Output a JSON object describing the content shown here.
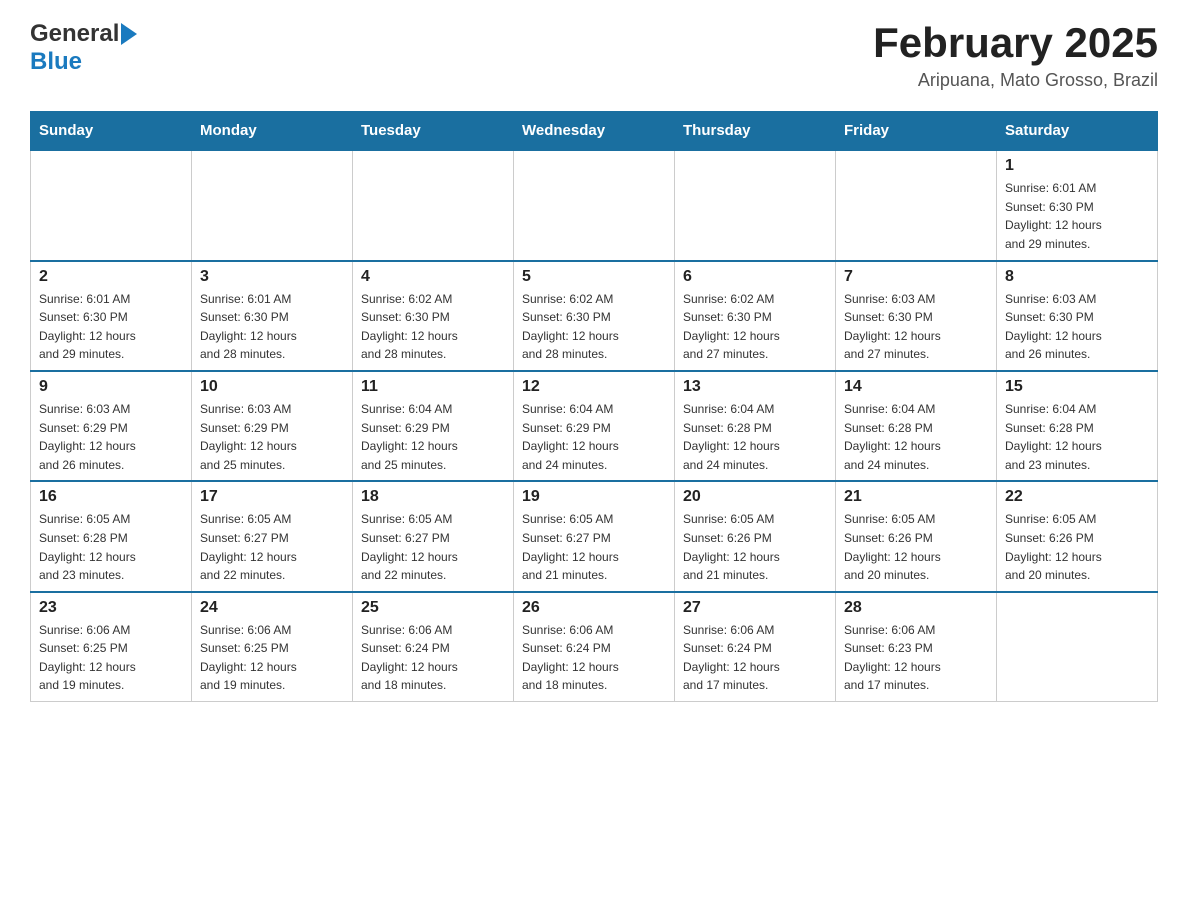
{
  "header": {
    "logo_general": "General",
    "logo_blue": "Blue",
    "title": "February 2025",
    "location": "Aripuana, Mato Grosso, Brazil"
  },
  "days_of_week": [
    "Sunday",
    "Monday",
    "Tuesday",
    "Wednesday",
    "Thursday",
    "Friday",
    "Saturday"
  ],
  "weeks": [
    {
      "days": [
        {
          "num": "",
          "info": ""
        },
        {
          "num": "",
          "info": ""
        },
        {
          "num": "",
          "info": ""
        },
        {
          "num": "",
          "info": ""
        },
        {
          "num": "",
          "info": ""
        },
        {
          "num": "",
          "info": ""
        },
        {
          "num": "1",
          "info": "Sunrise: 6:01 AM\nSunset: 6:30 PM\nDaylight: 12 hours\nand 29 minutes."
        }
      ]
    },
    {
      "days": [
        {
          "num": "2",
          "info": "Sunrise: 6:01 AM\nSunset: 6:30 PM\nDaylight: 12 hours\nand 29 minutes."
        },
        {
          "num": "3",
          "info": "Sunrise: 6:01 AM\nSunset: 6:30 PM\nDaylight: 12 hours\nand 28 minutes."
        },
        {
          "num": "4",
          "info": "Sunrise: 6:02 AM\nSunset: 6:30 PM\nDaylight: 12 hours\nand 28 minutes."
        },
        {
          "num": "5",
          "info": "Sunrise: 6:02 AM\nSunset: 6:30 PM\nDaylight: 12 hours\nand 28 minutes."
        },
        {
          "num": "6",
          "info": "Sunrise: 6:02 AM\nSunset: 6:30 PM\nDaylight: 12 hours\nand 27 minutes."
        },
        {
          "num": "7",
          "info": "Sunrise: 6:03 AM\nSunset: 6:30 PM\nDaylight: 12 hours\nand 27 minutes."
        },
        {
          "num": "8",
          "info": "Sunrise: 6:03 AM\nSunset: 6:30 PM\nDaylight: 12 hours\nand 26 minutes."
        }
      ]
    },
    {
      "days": [
        {
          "num": "9",
          "info": "Sunrise: 6:03 AM\nSunset: 6:29 PM\nDaylight: 12 hours\nand 26 minutes."
        },
        {
          "num": "10",
          "info": "Sunrise: 6:03 AM\nSunset: 6:29 PM\nDaylight: 12 hours\nand 25 minutes."
        },
        {
          "num": "11",
          "info": "Sunrise: 6:04 AM\nSunset: 6:29 PM\nDaylight: 12 hours\nand 25 minutes."
        },
        {
          "num": "12",
          "info": "Sunrise: 6:04 AM\nSunset: 6:29 PM\nDaylight: 12 hours\nand 24 minutes."
        },
        {
          "num": "13",
          "info": "Sunrise: 6:04 AM\nSunset: 6:28 PM\nDaylight: 12 hours\nand 24 minutes."
        },
        {
          "num": "14",
          "info": "Sunrise: 6:04 AM\nSunset: 6:28 PM\nDaylight: 12 hours\nand 24 minutes."
        },
        {
          "num": "15",
          "info": "Sunrise: 6:04 AM\nSunset: 6:28 PM\nDaylight: 12 hours\nand 23 minutes."
        }
      ]
    },
    {
      "days": [
        {
          "num": "16",
          "info": "Sunrise: 6:05 AM\nSunset: 6:28 PM\nDaylight: 12 hours\nand 23 minutes."
        },
        {
          "num": "17",
          "info": "Sunrise: 6:05 AM\nSunset: 6:27 PM\nDaylight: 12 hours\nand 22 minutes."
        },
        {
          "num": "18",
          "info": "Sunrise: 6:05 AM\nSunset: 6:27 PM\nDaylight: 12 hours\nand 22 minutes."
        },
        {
          "num": "19",
          "info": "Sunrise: 6:05 AM\nSunset: 6:27 PM\nDaylight: 12 hours\nand 21 minutes."
        },
        {
          "num": "20",
          "info": "Sunrise: 6:05 AM\nSunset: 6:26 PM\nDaylight: 12 hours\nand 21 minutes."
        },
        {
          "num": "21",
          "info": "Sunrise: 6:05 AM\nSunset: 6:26 PM\nDaylight: 12 hours\nand 20 minutes."
        },
        {
          "num": "22",
          "info": "Sunrise: 6:05 AM\nSunset: 6:26 PM\nDaylight: 12 hours\nand 20 minutes."
        }
      ]
    },
    {
      "days": [
        {
          "num": "23",
          "info": "Sunrise: 6:06 AM\nSunset: 6:25 PM\nDaylight: 12 hours\nand 19 minutes."
        },
        {
          "num": "24",
          "info": "Sunrise: 6:06 AM\nSunset: 6:25 PM\nDaylight: 12 hours\nand 19 minutes."
        },
        {
          "num": "25",
          "info": "Sunrise: 6:06 AM\nSunset: 6:24 PM\nDaylight: 12 hours\nand 18 minutes."
        },
        {
          "num": "26",
          "info": "Sunrise: 6:06 AM\nSunset: 6:24 PM\nDaylight: 12 hours\nand 18 minutes."
        },
        {
          "num": "27",
          "info": "Sunrise: 6:06 AM\nSunset: 6:24 PM\nDaylight: 12 hours\nand 17 minutes."
        },
        {
          "num": "28",
          "info": "Sunrise: 6:06 AM\nSunset: 6:23 PM\nDaylight: 12 hours\nand 17 minutes."
        },
        {
          "num": "",
          "info": ""
        }
      ]
    }
  ]
}
